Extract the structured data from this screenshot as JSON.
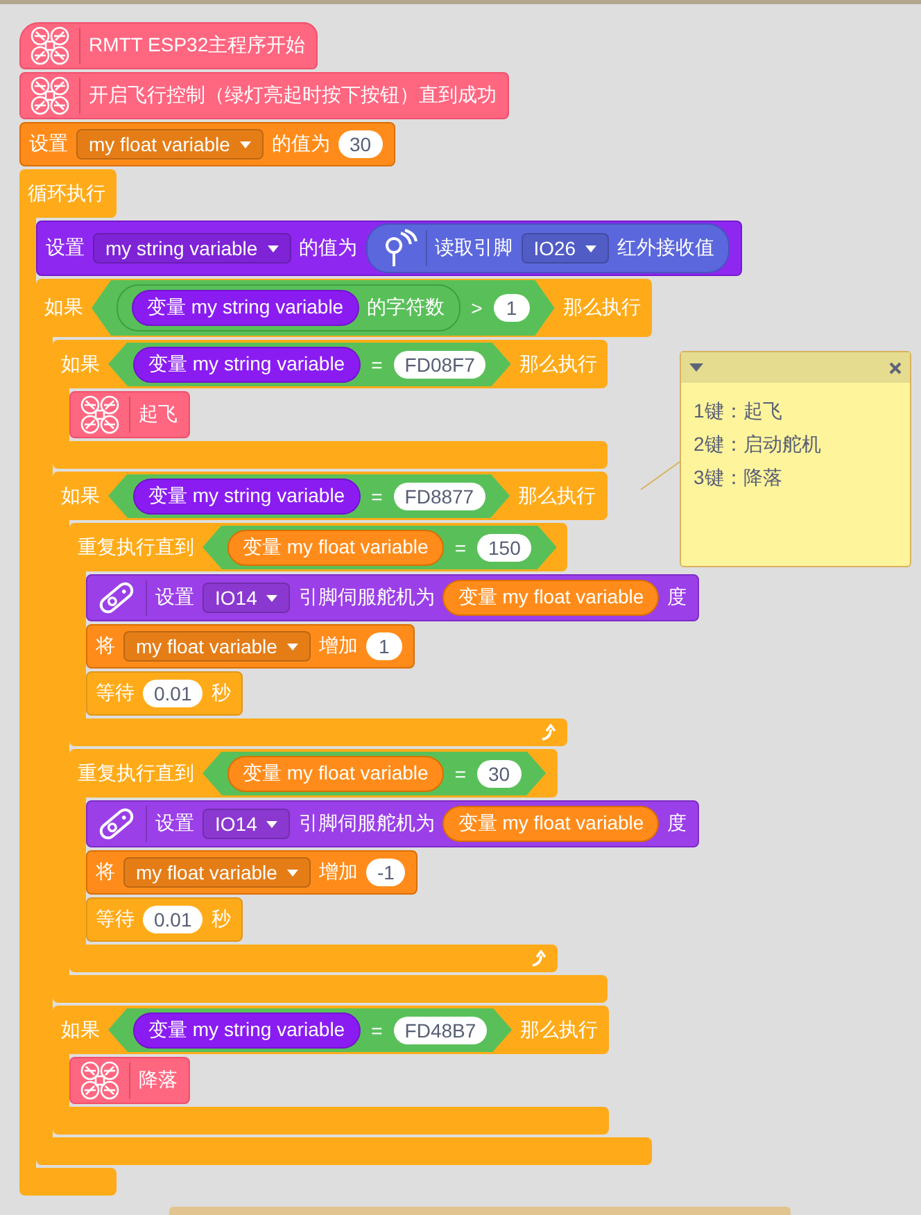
{
  "script": [
    {
      "kind": "drone_start",
      "parts": [
        {
          "kind": "text",
          "text": "RMTT ESP32主程序开始"
        }
      ]
    },
    {
      "kind": "drone",
      "parts": [
        {
          "kind": "text",
          "text": "开启飞行控制（绿灯亮起时按下按钮）直到成功"
        }
      ]
    },
    {
      "kind": "variable",
      "parts": [
        {
          "kind": "text",
          "text": "设置"
        },
        {
          "kind": "dropdown",
          "text": "my float variable"
        },
        {
          "kind": "text",
          "text": "的值为"
        },
        {
          "kind": "number",
          "text": "30"
        }
      ]
    },
    {
      "kind": "forever",
      "parts": [
        {
          "kind": "text",
          "text": "循环执行"
        }
      ],
      "children": [
        {
          "kind": "string_variable",
          "parts": [
            {
              "kind": "text",
              "text": "设置"
            },
            {
              "kind": "dropdown",
              "text": "my string variable"
            },
            {
              "kind": "text",
              "text": "的值为"
            },
            {
              "kind": "infrared_reporter",
              "parts": [
                {
                  "kind": "text",
                  "text": "读取引脚"
                },
                {
                  "kind": "dropdown",
                  "text": "IO26"
                },
                {
                  "kind": "text",
                  "text": "红外接收值"
                }
              ]
            }
          ]
        },
        {
          "kind": "if",
          "parts": [
            {
              "kind": "text",
              "text": "如果"
            },
            {
              "kind": "condition",
              "parts": [
                {
                  "kind": "operator_reporter",
                  "parts": [
                    {
                      "kind": "string_reporter",
                      "parts": [
                        {
                          "kind": "text",
                          "text": "变量 my string variable"
                        }
                      ]
                    },
                    {
                      "kind": "text",
                      "text": "的字符数"
                    }
                  ]
                },
                {
                  "kind": "text",
                  "text": ">"
                },
                {
                  "kind": "number",
                  "text": "1"
                }
              ]
            },
            {
              "kind": "text",
              "text": "那么执行"
            }
          ],
          "children": [
            {
              "kind": "if",
              "parts": [
                {
                  "kind": "text",
                  "text": "如果"
                },
                {
                  "kind": "condition",
                  "parts": [
                    {
                      "kind": "string_reporter",
                      "parts": [
                        {
                          "kind": "text",
                          "text": "变量 my string variable"
                        }
                      ]
                    },
                    {
                      "kind": "text",
                      "text": "="
                    },
                    {
                      "kind": "number",
                      "text": "FD08F7"
                    }
                  ]
                },
                {
                  "kind": "text",
                  "text": "那么执行"
                }
              ],
              "children": [
                {
                  "kind": "drone",
                  "parts": [
                    {
                      "kind": "text",
                      "text": "起飞"
                    }
                  ]
                }
              ]
            },
            {
              "kind": "if",
              "parts": [
                {
                  "kind": "text",
                  "text": "如果"
                },
                {
                  "kind": "condition",
                  "parts": [
                    {
                      "kind": "string_reporter",
                      "parts": [
                        {
                          "kind": "text",
                          "text": "变量 my string variable"
                        }
                      ]
                    },
                    {
                      "kind": "text",
                      "text": "="
                    },
                    {
                      "kind": "number",
                      "text": "FD8877"
                    }
                  ]
                },
                {
                  "kind": "text",
                  "text": "那么执行"
                }
              ],
              "children": [
                {
                  "kind": "repeat_until",
                  "parts": [
                    {
                      "kind": "text",
                      "text": "重复执行直到"
                    },
                    {
                      "kind": "condition",
                      "parts": [
                        {
                          "kind": "float_reporter",
                          "parts": [
                            {
                              "kind": "text",
                              "text": "变量 my float variable"
                            }
                          ]
                        },
                        {
                          "kind": "text",
                          "text": "="
                        },
                        {
                          "kind": "number",
                          "text": "150"
                        }
                      ]
                    }
                  ],
                  "children": [
                    {
                      "kind": "servo",
                      "parts": [
                        {
                          "kind": "text",
                          "text": "设置"
                        },
                        {
                          "kind": "dropdown",
                          "text": "IO14"
                        },
                        {
                          "kind": "text",
                          "text": "引脚伺服舵机为"
                        },
                        {
                          "kind": "float_reporter",
                          "parts": [
                            {
                              "kind": "text",
                              "text": "变量 my float variable"
                            }
                          ]
                        },
                        {
                          "kind": "text",
                          "text": "度"
                        }
                      ]
                    },
                    {
                      "kind": "variable",
                      "parts": [
                        {
                          "kind": "text",
                          "text": "将"
                        },
                        {
                          "kind": "dropdown",
                          "text": "my float variable"
                        },
                        {
                          "kind": "text",
                          "text": "增加"
                        },
                        {
                          "kind": "number",
                          "text": "1"
                        }
                      ]
                    },
                    {
                      "kind": "wait",
                      "parts": [
                        {
                          "kind": "text",
                          "text": "等待"
                        },
                        {
                          "kind": "number",
                          "text": "0.01"
                        },
                        {
                          "kind": "text",
                          "text": "秒"
                        }
                      ]
                    }
                  ]
                },
                {
                  "kind": "repeat_until",
                  "parts": [
                    {
                      "kind": "text",
                      "text": "重复执行直到"
                    },
                    {
                      "kind": "condition",
                      "parts": [
                        {
                          "kind": "float_reporter",
                          "parts": [
                            {
                              "kind": "text",
                              "text": "变量 my float variable"
                            }
                          ]
                        },
                        {
                          "kind": "text",
                          "text": "="
                        },
                        {
                          "kind": "number",
                          "text": "30"
                        }
                      ]
                    }
                  ],
                  "children": [
                    {
                      "kind": "servo",
                      "parts": [
                        {
                          "kind": "text",
                          "text": "设置"
                        },
                        {
                          "kind": "dropdown",
                          "text": "IO14"
                        },
                        {
                          "kind": "text",
                          "text": "引脚伺服舵机为"
                        },
                        {
                          "kind": "float_reporter",
                          "parts": [
                            {
                              "kind": "text",
                              "text": "变量 my float variable"
                            }
                          ]
                        },
                        {
                          "kind": "text",
                          "text": "度"
                        }
                      ]
                    },
                    {
                      "kind": "variable",
                      "parts": [
                        {
                          "kind": "text",
                          "text": "将"
                        },
                        {
                          "kind": "dropdown",
                          "text": "my float variable"
                        },
                        {
                          "kind": "text",
                          "text": "增加"
                        },
                        {
                          "kind": "number",
                          "text": "-1"
                        }
                      ]
                    },
                    {
                      "kind": "wait",
                      "parts": [
                        {
                          "kind": "text",
                          "text": "等待"
                        },
                        {
                          "kind": "number",
                          "text": "0.01"
                        },
                        {
                          "kind": "text",
                          "text": "秒"
                        }
                      ]
                    }
                  ]
                }
              ]
            },
            {
              "kind": "if",
              "parts": [
                {
                  "kind": "text",
                  "text": "如果"
                },
                {
                  "kind": "condition",
                  "parts": [
                    {
                      "kind": "string_reporter",
                      "parts": [
                        {
                          "kind": "text",
                          "text": "变量 my string variable"
                        }
                      ]
                    },
                    {
                      "kind": "text",
                      "text": "="
                    },
                    {
                      "kind": "number",
                      "text": "FD48B7"
                    }
                  ]
                },
                {
                  "kind": "text",
                  "text": "那么执行"
                }
              ],
              "children": [
                {
                  "kind": "drone",
                  "parts": [
                    {
                      "kind": "text",
                      "text": "降落"
                    }
                  ]
                }
              ]
            }
          ]
        }
      ]
    }
  ],
  "comment": {
    "lines": [
      "1键：起飞",
      "2键：启动舵机",
      "3键：降落"
    ]
  }
}
